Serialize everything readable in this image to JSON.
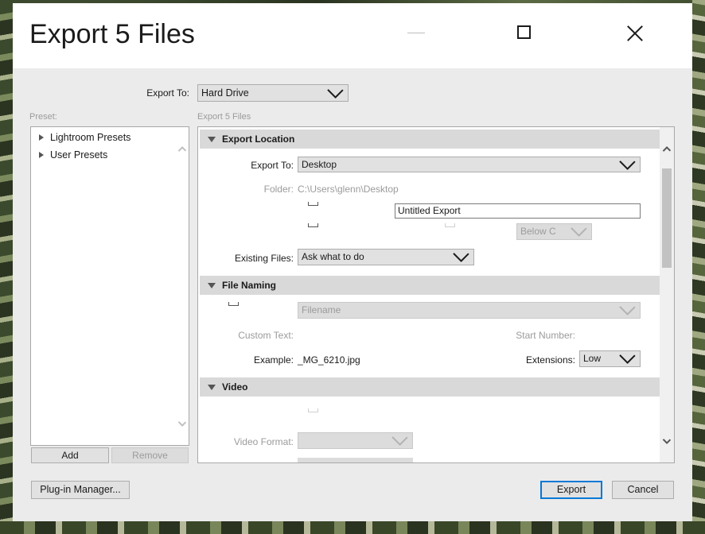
{
  "window": {
    "title": "Export 5 Files"
  },
  "export_to": {
    "label": "Export To:",
    "value": "Hard Drive"
  },
  "preset": {
    "label": "Preset:",
    "items": [
      {
        "label": "Lightroom Presets"
      },
      {
        "label": "User Presets"
      }
    ],
    "add_label": "Add",
    "remove_label": "Remove"
  },
  "settings_panel": {
    "caption": "Export 5 Files"
  },
  "export_location": {
    "header": "Export Location",
    "export_to_label": "Export To:",
    "export_to_value": "Desktop",
    "folder_label": "Folder:",
    "folder_value": "C:\\Users\\glenn\\Desktop",
    "subfolder_value": "Untitled Export",
    "below_value": "Below C",
    "existing_files_label": "Existing Files:",
    "existing_files_value": "Ask what to do"
  },
  "file_naming": {
    "header": "File Naming",
    "template_value": "Filename",
    "custom_text_label": "Custom Text:",
    "start_number_label": "Start Number:",
    "example_label": "Example:",
    "example_value": "_MG_6210.jpg",
    "extensions_label": "Extensions:",
    "extensions_value": "Low"
  },
  "video": {
    "header": "Video",
    "video_format_label": "Video Format:"
  },
  "footer": {
    "plugin_manager_label": "Plug-in Manager...",
    "export_label": "Export",
    "cancel_label": "Cancel"
  }
}
